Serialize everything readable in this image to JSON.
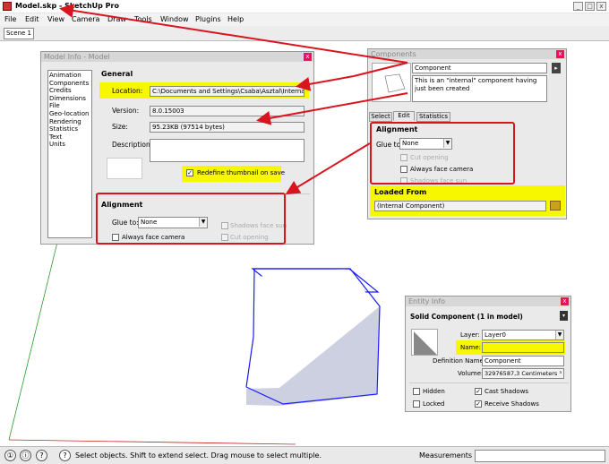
{
  "window": {
    "title": "Model.skp - SketchUp Pro",
    "min": "_",
    "max": "□",
    "close": "x"
  },
  "menu": [
    "File",
    "Edit",
    "View",
    "Camera",
    "Draw",
    "Tools",
    "Window",
    "Plugins",
    "Help"
  ],
  "scene_tab": "Scene 1",
  "model_info": {
    "title": "Model Info - Model",
    "nav": [
      "Animation",
      "Components",
      "Credits",
      "Dimensions",
      "File",
      "Geo-location",
      "Rendering",
      "Statistics",
      "Text",
      "Units"
    ],
    "selected_nav": "File",
    "general_heading": "General",
    "location_label": "Location:",
    "location_value": "C:\\Documents and Settings\\Csaba\\Asztal\\Internal-e",
    "version_label": "Version:",
    "version_value": "8.0.15003",
    "size_label": "Size:",
    "size_value": "95.23KB (97514 bytes)",
    "description_label": "Description:",
    "description_value": "",
    "redefine_label": "Redefine thumbnail on save",
    "redefine_checked": true,
    "alignment_heading": "Alignment",
    "glue_label": "Glue to:",
    "glue_value": "None",
    "shadows_label": "Shadows face sun",
    "always_face_label": "Always face camera",
    "cut_opening_label": "Cut opening"
  },
  "components": {
    "title": "Components",
    "name_value": "Component",
    "description_value": "This is an \"internal\" component having just been created",
    "tabs": [
      "Select",
      "Edit",
      "Statistics"
    ],
    "active_tab": "Edit",
    "alignment_heading": "Alignment",
    "glue_label": "Glue to:",
    "glue_value": "None",
    "cut_opening_label": "Cut opening",
    "always_face_label": "Always face camera",
    "shadows_label": "Shadows face sun",
    "loaded_from_heading": "Loaded From",
    "loaded_from_value": "(Internal Component)"
  },
  "entity_info": {
    "title": "Entity Info",
    "heading": "Solid Component (1 in model)",
    "layer_label": "Layer:",
    "layer_value": "Layer0",
    "name_label": "Name:",
    "name_value": "",
    "def_label": "Definition Name:",
    "def_value": "Component",
    "volume_label": "Volume:",
    "volume_value": "32976587,3 Centimeters ³",
    "hidden_label": "Hidden",
    "locked_label": "Locked",
    "cast_label": "Cast Shadows",
    "receive_label": "Receive Shadows",
    "hidden_checked": false,
    "locked_checked": false,
    "cast_checked": true,
    "receive_checked": true
  },
  "status": {
    "message": "Select objects. Shift to extend select. Drag mouse to select multiple.",
    "measurements_label": "Measurements",
    "circle_1": "①",
    "circle_2": "ⓘ",
    "circle_3": "?",
    "help_icon": "?"
  },
  "colors": {
    "highlight": "#f7f700",
    "annotation_red": "#d9141e",
    "box_edge": "#1a1aff"
  }
}
